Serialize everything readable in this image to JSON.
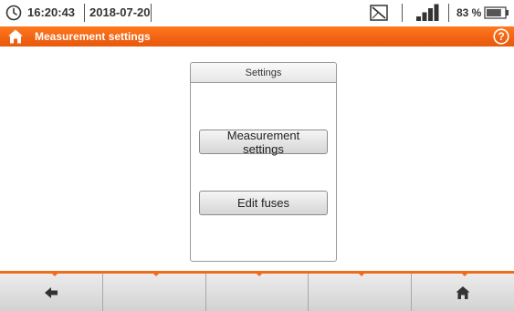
{
  "status": {
    "time": "16:20:43",
    "date": "2018-07-20",
    "battery_percent": "83 %",
    "battery_level": 0.83,
    "signal_bars_filled": 4,
    "signal_bars_total": 4
  },
  "title_bar": {
    "title": "Measurement settings",
    "color": "#f26413"
  },
  "panel": {
    "header": "Settings",
    "buttons": {
      "measurement_settings": "Measurement settings",
      "edit_fuses": "Edit fuses"
    }
  },
  "toolbar": {
    "items": [
      {
        "icon": "back-arrow-icon"
      },
      {
        "icon": ""
      },
      {
        "icon": ""
      },
      {
        "icon": ""
      },
      {
        "icon": "home-icon"
      }
    ],
    "accent": "#f26a1b"
  },
  "icons": {
    "clock": "clock-icon",
    "no_signal": "no-signal-icon",
    "signal": "signal-strength-icon",
    "battery": "battery-icon",
    "home": "home-icon",
    "help": "help-icon"
  }
}
